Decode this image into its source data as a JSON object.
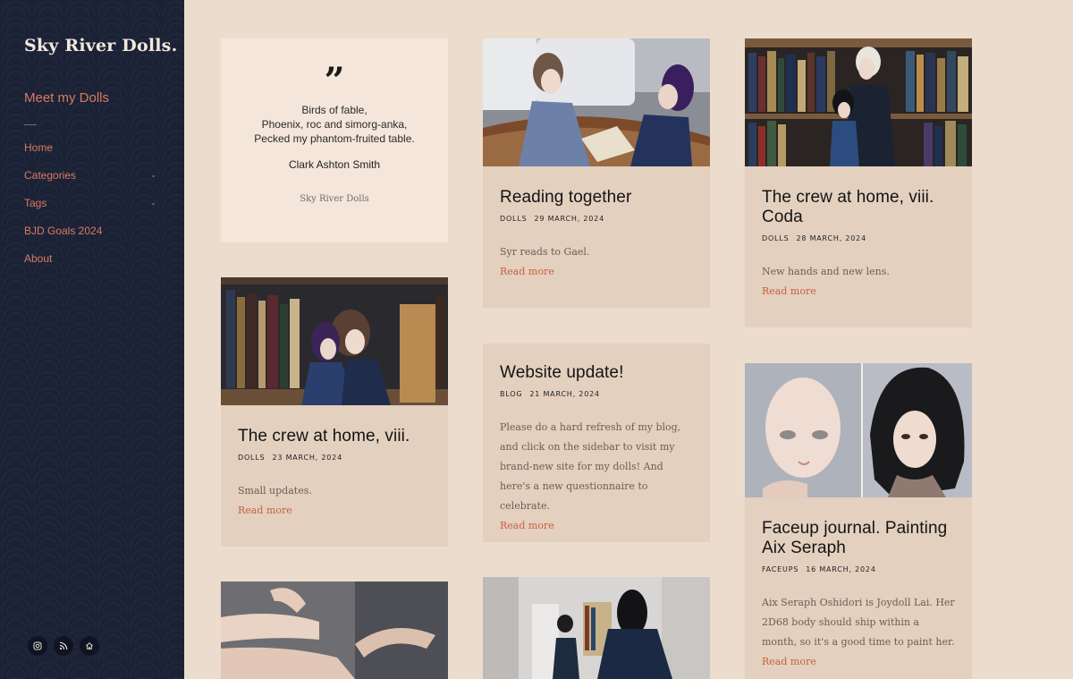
{
  "site": {
    "title": "Sky River Dolls."
  },
  "sidebar": {
    "meet_link": "Meet my Dolls",
    "nav": [
      {
        "label": "Home",
        "has_children": false
      },
      {
        "label": "Categories",
        "has_children": true
      },
      {
        "label": "Tags",
        "has_children": true
      },
      {
        "label": "BJD Goals 2024",
        "has_children": false
      },
      {
        "label": "About",
        "has_children": false
      }
    ],
    "socials": [
      "instagram-icon",
      "rss-icon",
      "home-icon"
    ]
  },
  "quote": {
    "lines": [
      "Birds of fable,",
      "Phoenix, roc and simorg-anka,",
      "Pecked my phantom-fruited table."
    ],
    "author": "Clark Ashton Smith",
    "source": "Sky River Dolls"
  },
  "posts": [
    {
      "title": "Reading together",
      "category": "DOLLS",
      "date": "29 MARCH, 2024",
      "excerpt": "Syr reads to Gael.",
      "more": "Read more"
    },
    {
      "title": "The crew at home, viii. Coda",
      "category": "DOLLS",
      "date": "28 MARCH, 2024",
      "excerpt": "New hands and new lens.",
      "more": "Read more"
    },
    {
      "title": "The crew at home, viii.",
      "category": "DOLLS",
      "date": "23 MARCH, 2024",
      "excerpt": "Small updates.",
      "more": "Read more"
    },
    {
      "title": "Website update!",
      "category": "BLOG",
      "date": "21 MARCH, 2024",
      "excerpt": "Please do a hard refresh of my blog, and click on the sidebar to visit my brand-new site for my dolls! And here's a new questionnaire to celebrate.",
      "more": "Read more"
    },
    {
      "title": "Faceup journal. Painting Aix Seraph",
      "category": "FACEUPS",
      "date": "16 MARCH, 2024",
      "excerpt": "Aix Seraph Oshidori is Joydoll Lai.  Her 2D68 body should ship within a month, so it's a good time to paint her.",
      "more": "Read more"
    }
  ],
  "colors": {
    "sidebar_bg": "#1b2236",
    "page_bg": "#ecdccd",
    "card_bg": "#e3d0be",
    "accent": "#d97a60",
    "link": "#c85f42"
  }
}
